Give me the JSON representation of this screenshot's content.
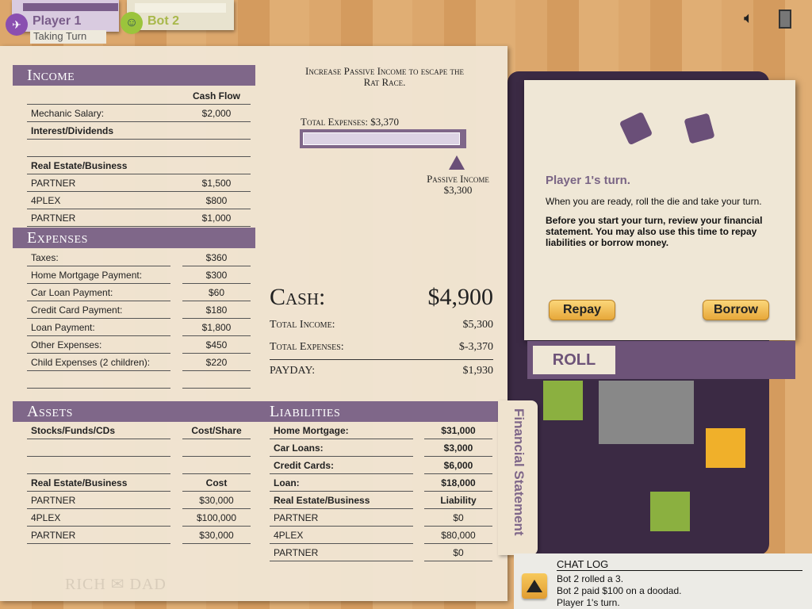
{
  "players": [
    {
      "name": "Player 1",
      "status": "Taking Turn",
      "icon": "helicopter-icon",
      "color": "#8a4fb0"
    },
    {
      "name": "Bot 2",
      "icon": "person-icon",
      "color": "#9bc43c"
    }
  ],
  "top_icons": [
    "speaker-icon",
    "exit-door-icon"
  ],
  "income": {
    "title": "Income",
    "col_header": "Cash Flow",
    "rows": [
      {
        "label": "Mechanic Salary:",
        "value": "$2,000"
      },
      {
        "label": "Interest/Dividends",
        "value": "",
        "bold": true
      },
      {
        "label": "",
        "value": ""
      },
      {
        "label": "Real Estate/Business",
        "value": "",
        "bold": true
      },
      {
        "label": "PARTNER",
        "value": "$1,500"
      },
      {
        "label": "4PLEX",
        "value": "$800"
      },
      {
        "label": "PARTNER",
        "value": "$1,000"
      }
    ]
  },
  "expenses": {
    "title": "Expenses",
    "rows": [
      {
        "label": "Taxes:",
        "value": "$360"
      },
      {
        "label": "Home Mortgage Payment:",
        "value": "$300"
      },
      {
        "label": "Car Loan Payment:",
        "value": "$60"
      },
      {
        "label": "Credit Card Payment:",
        "value": "$180"
      },
      {
        "label": "Loan Payment:",
        "value": "$1,800"
      },
      {
        "label": "Other Expenses:",
        "value": "$450"
      },
      {
        "label": "Child Expenses (2 children):",
        "value": "$220"
      },
      {
        "label": "",
        "value": ""
      }
    ]
  },
  "assets": {
    "title": "Assets",
    "rows": [
      {
        "label": "Stocks/Funds/CDs",
        "value": "Cost/Share",
        "bold": true
      },
      {
        "label": "",
        "value": ""
      },
      {
        "label": "",
        "value": ""
      },
      {
        "label": "Real Estate/Business",
        "value": "Cost",
        "bold": true
      },
      {
        "label": "PARTNER",
        "value": "$30,000"
      },
      {
        "label": "4PLEX",
        "value": "$100,000"
      },
      {
        "label": "PARTNER",
        "value": "$30,000"
      }
    ]
  },
  "liabilities": {
    "title": "Liabilities",
    "rows": [
      {
        "label": "Home Mortgage:",
        "value": "$31,000",
        "bold": true
      },
      {
        "label": "Car Loans:",
        "value": "$3,000",
        "bold": true
      },
      {
        "label": "Credit Cards:",
        "value": "$6,000",
        "bold": true
      },
      {
        "label": "Loan:",
        "value": "$18,000",
        "bold": true
      },
      {
        "label": "Real Estate/Business",
        "value": "Liability",
        "bold": true
      },
      {
        "label": "PARTNER",
        "value": "$0"
      },
      {
        "label": "4PLEX",
        "value": "$80,000"
      },
      {
        "label": "PARTNER",
        "value": "$0"
      }
    ]
  },
  "goal": {
    "text": "Increase Passive Income to escape the Rat Race.",
    "total_expenses_label": "Total Expenses: $3,370",
    "passive_label": "Passive Income",
    "passive_value": "$3,300",
    "progress": 0.979
  },
  "summary": {
    "cash_label": "Cash:",
    "cash_value": "$4,900",
    "total_income_label": "Total Income:",
    "total_income": "$5,300",
    "total_expenses_label": "Total Expenses:",
    "total_expenses": "$-3,370",
    "payday_label": "PAYDAY:",
    "payday": "$1,930"
  },
  "tab_label": "Financial Statement",
  "logo": "RICH DAD",
  "dialog": {
    "title": "Player 1's turn.",
    "line1": "When you are ready, roll the die and take your turn.",
    "line2": "Before you start your turn, review your financial statement. You may also use this time to repay liabilities or borrow money.",
    "repay": "Repay",
    "borrow": "Borrow"
  },
  "roll_label": "ROLL",
  "chat": {
    "title": "CHAT LOG",
    "lines": [
      "Bot 2 rolled a 3.",
      "Bot 2 paid $100 on a doodad.",
      "Player 1's turn."
    ]
  },
  "colors": {
    "accent": "#7f6789",
    "button": "#f3c35a"
  }
}
